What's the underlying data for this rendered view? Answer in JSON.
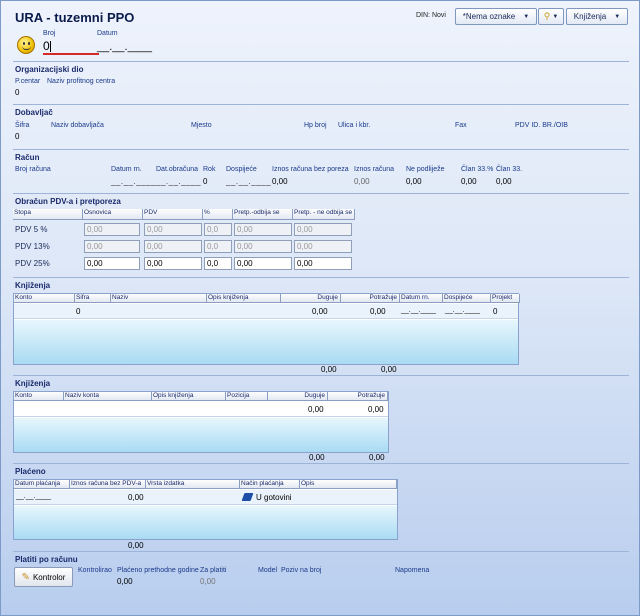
{
  "header": {
    "title": "URA - tuzemni PPO",
    "din": "DIN: Novi",
    "tag_select": "*Nema oznake",
    "search_btn": "",
    "book_btn": "Knjiženja"
  },
  "top": {
    "broj_label": "Broj",
    "broj_value": "0",
    "datum_label": "Datum",
    "datum_value": "__.__.____"
  },
  "org": {
    "title": "Organizacijski dio",
    "pcentar_label": "P.centar",
    "naziv_label": "Naziv profitnog centra",
    "pcentar_value": "0"
  },
  "dob": {
    "title": "Dobavljač",
    "sifra": "Šifra",
    "naziv": "Naziv dobavljača",
    "mjesto": "Mjesto",
    "hp": "Hp broj",
    "ulica": "Ulica i kbr.",
    "fax": "Fax",
    "pdv": "PDV ID. BR./OIB",
    "sifra_value": "0"
  },
  "racun": {
    "title": "Račun",
    "broj_racuna": "Broj računa",
    "datum_rn": "Datum rn.",
    "dat_obracuna": "Dat.obračuna",
    "rok": "Rok",
    "dospijece": "Dospijeće",
    "iznos_bez": "Iznos računa bez poreza",
    "iznos": "Iznos računa",
    "ne_podlijeze": "Ne podliježe",
    "clan33p": "Član 33.%",
    "clan33": "Član 33.",
    "date1": "__.__.____",
    "date2": "__.__.____",
    "rok_value": "0",
    "date3": "__.__.____",
    "iznos_bez_value": "0,00",
    "iznos_value": "0,00",
    "ne_value": "0,00",
    "clan33p_value": "0,00",
    "clan33_value": "0,00"
  },
  "pdv": {
    "title": "Obračun PDV-a i pretporeza",
    "cols": [
      "Stopa",
      "Osnovica",
      "PDV",
      "%",
      "Pretp.-odbija se",
      "Pretp. - ne odbija se"
    ],
    "rows": [
      {
        "label": "PDV 5 %",
        "v": [
          "0,00",
          "0,00",
          "0,0",
          "0,00",
          "0,00"
        ]
      },
      {
        "label": "PDV 13%",
        "v": [
          "0,00",
          "0,00",
          "0,0",
          "0,00",
          "0,00"
        ]
      },
      {
        "label": "PDV 25%",
        "v": [
          "0,00",
          "0,00",
          "0,0",
          "0,00",
          "0,00"
        ]
      }
    ]
  },
  "knj1": {
    "title": "Knjiženja",
    "cols": [
      "Konto",
      "Šifra",
      "Naziv",
      "Opis knjiženja",
      "Duguje",
      "Potražuje",
      "Datum rn.",
      "Dospijeće",
      "Projekt"
    ],
    "row": {
      "sifra": "0",
      "duguje": "0,00",
      "potrazuje": "0,00",
      "datum": "__.__.____",
      "dospijece": "__.__.____",
      "projekt": "0"
    },
    "sum_d": "0,00",
    "sum_p": "0,00"
  },
  "knj2": {
    "title": "Knjiženja",
    "cols": [
      "Konto",
      "Naziv konta",
      "Opis knjiženja",
      "Pozicija",
      "Duguje",
      "Potražuje"
    ],
    "row": {
      "duguje": "0,00",
      "potrazuje": "0,00"
    },
    "sum_d": "0,00",
    "sum_p": "0,00"
  },
  "placeno": {
    "title": "Plaćeno",
    "cols": [
      "Datum plaćanja",
      "Iznos računa bez PDV-a",
      "Vrsta izdatka",
      "Način plaćanja",
      "Opis"
    ],
    "row": {
      "datum": "__.__.____",
      "iznos": "0,00",
      "nacin": "U gotovini"
    },
    "sum": "0,00"
  },
  "platiti": {
    "title": "Platiti po računu",
    "kontrola_btn": "Kontrolor",
    "kontrolirao": "Kontrolirao",
    "placeno_prethodne": "Plaćeno prethodne godine",
    "za_platiti": "Za platiti",
    "model": "Model",
    "poziv": "Poziv na broj",
    "napomena": "Napomena",
    "placeno_value": "0,00",
    "za_value": "0,00"
  },
  "colors": {
    "accent": "#1a3a8a",
    "grid_fill": "#a9dbf3"
  }
}
